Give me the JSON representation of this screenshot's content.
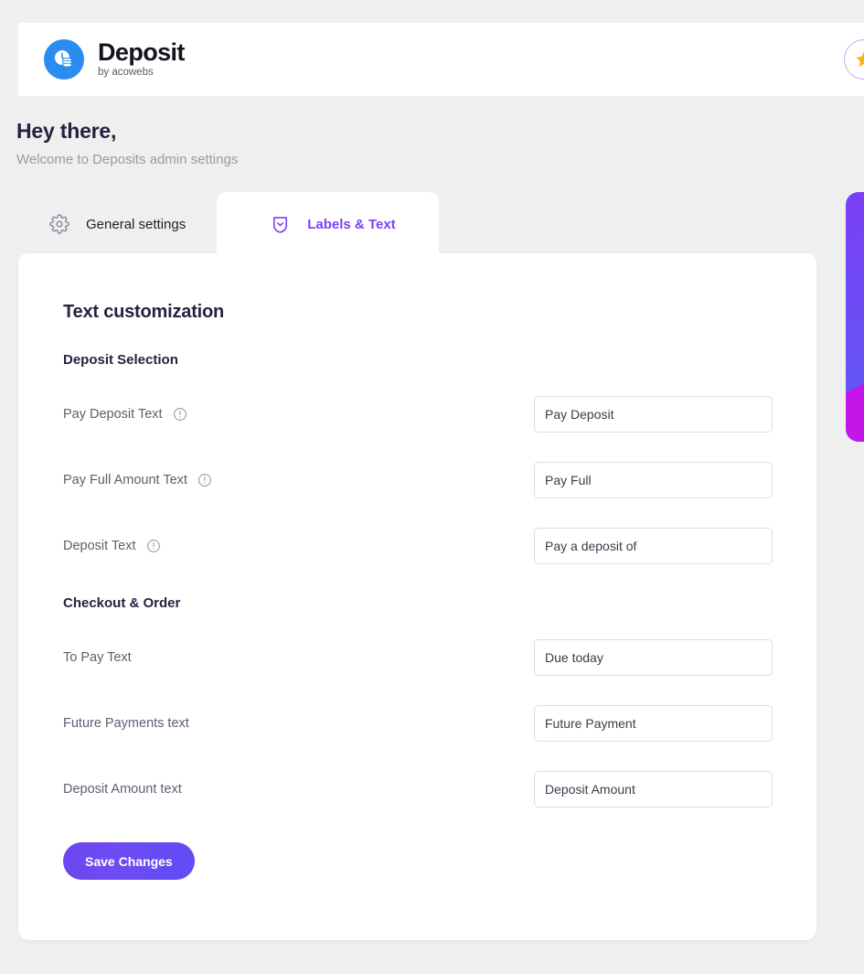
{
  "header": {
    "brand_title": "Deposit",
    "brand_subtitle": "by acowebs",
    "logo_icon": "clock-coins-icon",
    "badge_icon": "star-icon"
  },
  "greeting": {
    "title": "Hey there,",
    "subtitle": "Welcome to Deposits admin settings"
  },
  "tabs": [
    {
      "label": "General settings",
      "icon": "gear-icon",
      "active": false
    },
    {
      "label": "Labels & Text",
      "icon": "shield-chevron-icon",
      "active": true
    }
  ],
  "card": {
    "title": "Text customization",
    "sections": [
      {
        "title": "Deposit Selection",
        "fields": [
          {
            "label": "Pay Deposit Text",
            "value": "Pay Deposit",
            "placeholder": "Pay Deposit",
            "info": true
          },
          {
            "label": "Pay Full Amount Text",
            "value": "Pay Full",
            "placeholder": "Pay Full",
            "info": true
          },
          {
            "label": "Deposit Text",
            "value": "Pay a deposit of",
            "placeholder": "Pay a deposit of",
            "info": true
          }
        ]
      },
      {
        "title": "Checkout & Order",
        "fields": [
          {
            "label": "To Pay Text",
            "value": "Due today",
            "placeholder": "Due today",
            "info": false
          },
          {
            "label": "Future Payments text",
            "value": "Future Payment",
            "placeholder": "Future Payment",
            "info": false
          },
          {
            "label": "Deposit Amount text",
            "value": "Deposit Amount",
            "placeholder": "Deposit Amount",
            "info": false
          }
        ]
      }
    ],
    "save_label": "Save Changes"
  },
  "colors": {
    "accent_purple": "#7b42f6",
    "brand_blue": "#2b8cf0",
    "panel_magenta": "#c516ea",
    "star_yellow": "#fbb117",
    "heading_navy": "#232340"
  }
}
